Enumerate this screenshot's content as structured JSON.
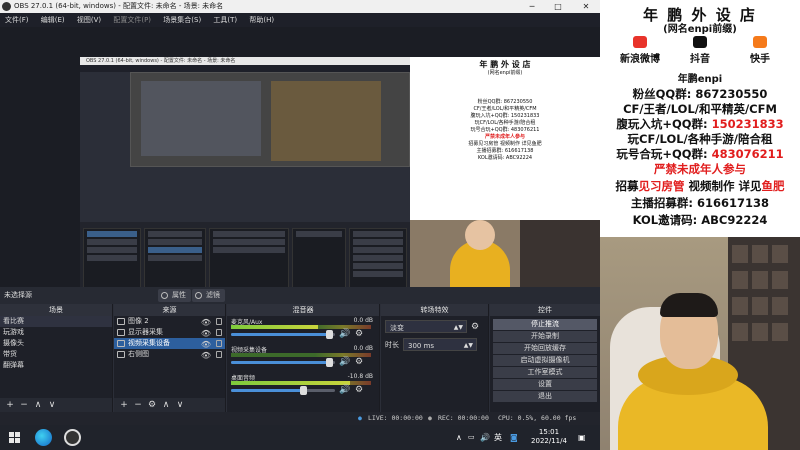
{
  "window": {
    "title": "OBS 27.0.1 (64-bit, windows) - 配置文件: 未命名 - 场景: 未命名",
    "minimize": "─",
    "maximize": "□",
    "close": "✕"
  },
  "menu": [
    "文件(F)",
    "编辑(E)",
    "视图(V)",
    "配置文件(P)",
    "场景集合(S)",
    "工具(T)",
    "帮助(H)"
  ],
  "nested": {
    "title": "OBS 27.0.1 (64-bit, windows) - 配置文件: 未命名 - 场景: 未命名"
  },
  "mini_poster": {
    "title": "年 鹏 外 设 店",
    "sub": "(网名enpi前缀)",
    "l1": "粉丝QQ群: 867230550",
    "l2": "CF/王者/LOL/和平精英/CFM",
    "l3": "腹玩入坑+QQ群: 150231833",
    "l4": "玩CF/LOL/各种手游/陪合租",
    "l5": "玩号合玩+QQ群: 483076211",
    "l6": "严禁未成年人参与",
    "l7": "招募见习房管 视频制作 详见鱼肥",
    "l8": "主播招募群: 616617138",
    "l9": "KOL邀请码: ABC92224"
  },
  "status_line": {
    "no_source": "未选择源",
    "properties": "属性",
    "filters": "滤镜"
  },
  "scenes": {
    "header": "场景",
    "items": [
      "看比赛",
      "玩游戏",
      "摄像头",
      "带货",
      "翻弹幕"
    ],
    "selected": 0,
    "footer": [
      "+",
      "−",
      "∧",
      "∨"
    ]
  },
  "sources": {
    "header": "来源",
    "items": [
      "图像 2",
      "显示器采集",
      "视频采集设备",
      "右侧图"
    ],
    "selected": 2,
    "eye": "👁",
    "footer": [
      "+",
      "−",
      "⚙",
      "∧",
      "∨"
    ]
  },
  "mixer": {
    "header": "混音器",
    "channels": [
      {
        "name": "麦克风/Aux",
        "db": "0.0 dB",
        "level": 0.62,
        "volume": 0.95
      },
      {
        "name": "视频采集设备",
        "db": "0.0 dB",
        "level": 0.0,
        "volume": 0.95
      },
      {
        "name": "桌面音频",
        "db": "-10.8 dB",
        "level": 0.85,
        "volume": 0.7
      }
    ],
    "speaker_icon": "🔊",
    "gear_icon": "⚙"
  },
  "transitions": {
    "header": "转场特效",
    "type": "淡变",
    "duration_label": "时长",
    "duration": "300 ms",
    "arrows": "▲▼"
  },
  "controls": {
    "header": "控件",
    "buttons": [
      "停止推流",
      "开始录制",
      "开始回放缓存",
      "启动虚拟摄像机",
      "工作室模式",
      "设置",
      "退出"
    ]
  },
  "statusbar": {
    "live": "LIVE: 00:00:00",
    "rec": "REC: 00:00:00",
    "cpu": "CPU: 0.5%, 60.00 fps"
  },
  "taskbar": {
    "lang": "英",
    "time": "15:01",
    "date": "2022/11/4",
    "tray_up": "∧"
  },
  "poster": {
    "title": "年 鹏 外 设 店",
    "subtitle": "(网名enpi前缀)",
    "weibo": "新浪微博",
    "douyin": "抖音",
    "kuaishou": "快手",
    "name": "年鹏enpi",
    "qq_label": "粉丝QQ群:",
    "qq": "867230550",
    "games1": "CF/王者/LOL/和平精英/CFM",
    "group1_label": "腹玩入坑+QQ群:",
    "group1": "150231833",
    "games2": "玩CF/LOL/各种手游/陪合租",
    "group2_label": "玩号合玩+QQ群:",
    "group2": "483076211",
    "warning": "严禁未成年人参与",
    "recruit_a": "招募",
    "recruit_b": "见习房管",
    "recruit_c": " 视频制作",
    "recruit_d": " 详见",
    "recruit_e": "鱼肥",
    "anchor_label": "主播招募群:",
    "anchor": "616617138",
    "kol_label": "KOL邀请码:",
    "kol": "ABC92224"
  },
  "colors": {
    "obs_bg": "#2b2e38",
    "selection": "#2d5f9e",
    "poster_red": "#e11d1d",
    "hoodie": "#eab826"
  }
}
